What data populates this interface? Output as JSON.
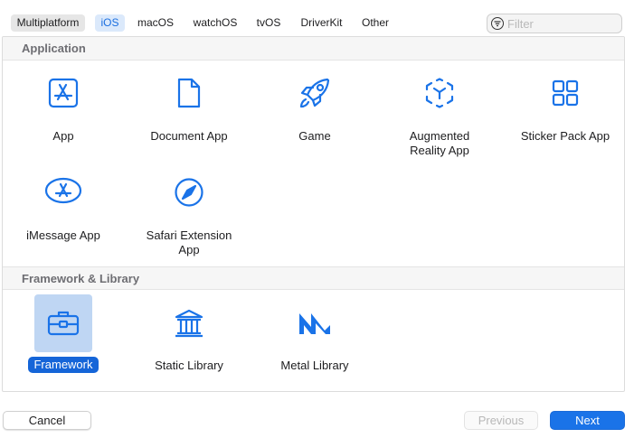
{
  "platform_tabs": [
    {
      "label": "Multiplatform",
      "selected": false
    },
    {
      "label": "iOS",
      "selected": true
    },
    {
      "label": "macOS",
      "selected": false
    },
    {
      "label": "watchOS",
      "selected": false
    },
    {
      "label": "tvOS",
      "selected": false
    },
    {
      "label": "DriverKit",
      "selected": false
    },
    {
      "label": "Other",
      "selected": false
    }
  ],
  "filter": {
    "placeholder": "Filter"
  },
  "sections": [
    {
      "title": "Application",
      "templates": [
        {
          "label": "App",
          "icon": "app-store-icon"
        },
        {
          "label": "Document App",
          "icon": "document-icon"
        },
        {
          "label": "Game",
          "icon": "rocket-icon"
        },
        {
          "label": "Augmented\nReality App",
          "icon": "ar-cube-icon"
        },
        {
          "label": "Sticker Pack App",
          "icon": "grid-icon"
        },
        {
          "label": "iMessage App",
          "icon": "imessage-app-icon"
        },
        {
          "label": "Safari Extension\nApp",
          "icon": "compass-icon"
        }
      ]
    },
    {
      "title": "Framework & Library",
      "templates": [
        {
          "label": "Framework",
          "icon": "toolbox-icon",
          "selected": true
        },
        {
          "label": "Static Library",
          "icon": "library-building-icon"
        },
        {
          "label": "Metal Library",
          "icon": "metal-icon"
        }
      ]
    }
  ],
  "buttons": {
    "cancel": "Cancel",
    "previous": "Previous",
    "next": "Next"
  },
  "colors": {
    "accent": "#1a73e8",
    "icon": "#1a73e8",
    "selection_bg": "#bfd6f3"
  }
}
